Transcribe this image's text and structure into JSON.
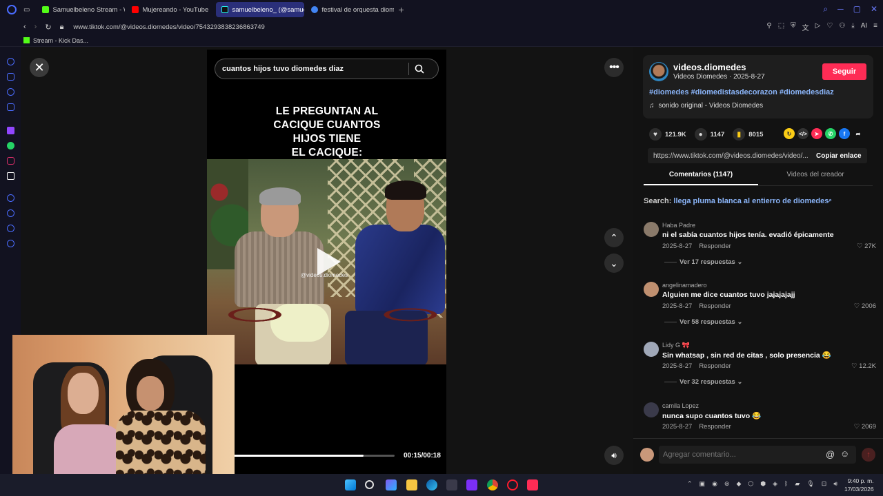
{
  "browser": {
    "tabs": [
      {
        "label": "Samuelbeleno Stream - W",
        "color": "#53fc18",
        "active": false
      },
      {
        "label": "Mujereando - YouTube",
        "color": "#ff0000",
        "active": false
      },
      {
        "label": "samuelbeleno_ (@samueli",
        "color": "#000000",
        "active": true
      },
      {
        "label": "festival de orquesta diome",
        "color": "#4285f4",
        "active": false
      }
    ],
    "new_tab": "+",
    "url": "www.tiktok.com/@videos.diomedes/video/7543293838236863749",
    "bookmark": "Stream - Kick Das..."
  },
  "video": {
    "search_value": "cuantos hijos tuvo diomedes diaz",
    "caption_lines": [
      "LE PREGUNTAN AL",
      "CACIQUE CUANTOS",
      "HIJOS TIENE",
      "EL CACIQUE:"
    ],
    "watermark": "@videos.diomedes",
    "time": "00:15/00:18",
    "progress": 0.83
  },
  "author": {
    "username": "videos.diomedes",
    "subline": "Videos Diomedes · 2025-8-27",
    "follow_label": "Seguir",
    "hashtags": "#diomedes #diomedistasdecorazon #diomedesdiaz",
    "sound": "sonido original - Videos Diomedes"
  },
  "actions": {
    "likes": "121.9K",
    "comments": "1147",
    "saves": "8015"
  },
  "link": {
    "url": "https://www.tiktok.com/@videos.diomedes/video/...",
    "copy_label": "Copiar enlace"
  },
  "tabs": {
    "comments": "Comentarios (1147)",
    "creator": "Videos del creador"
  },
  "search_suggestion": {
    "prefix": "Search:",
    "query": "llega pluma blanca al entierro de diomedes"
  },
  "comments": [
    {
      "user": "Haba Padre",
      "text": "ni el sabía cuantos hijos tenía. evadió épicamente",
      "date": "2025-8-27",
      "reply": "Responder",
      "likes": "27K",
      "replies": "Ver 17 respuestas ⌄",
      "avatar_color": "#8a7a6a"
    },
    {
      "user": "angelinamadero",
      "text": "Alguien me dice cuantos tuvo jajajajajj",
      "date": "2025-8-27",
      "reply": "Responder",
      "likes": "2006",
      "replies": "Ver 58 respuestas ⌄",
      "avatar_color": "#c09070"
    },
    {
      "user": "Lidy G 🎀",
      "text": "Sin whatsap , sin red de citas , solo presencia 😂",
      "date": "2025-8-27",
      "reply": "Responder",
      "likes": "12.2K",
      "replies": "Ver 32 respuestas ⌄",
      "avatar_color": "#a0a8b8"
    },
    {
      "user": "camila Lopez",
      "text": "nunca supo cuantos tuvo 😂",
      "date": "2025-8-27",
      "reply": "Responder",
      "likes": "2069",
      "replies": "",
      "avatar_color": "#3a3a4a"
    }
  ],
  "comment_input": {
    "placeholder": "Agregar comentario..."
  },
  "taskbar": {
    "time": "9:40 p. m.",
    "date": "17/03/2026"
  }
}
